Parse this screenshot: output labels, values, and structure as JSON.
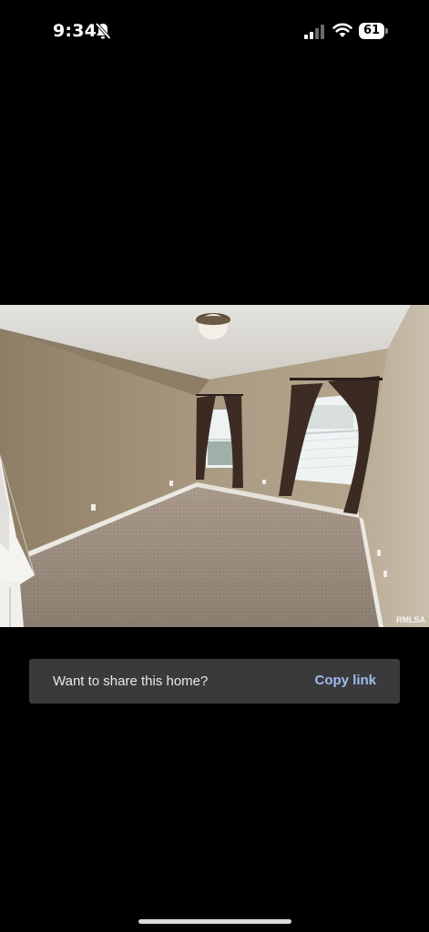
{
  "status_bar": {
    "time": "9:34",
    "battery_level": "61",
    "icons": [
      "bell-slash-icon",
      "cellular-signal-icon",
      "wifi-icon",
      "battery-icon"
    ]
  },
  "photo": {
    "watermark": "RMLSA"
  },
  "share": {
    "prompt": "Want to share this home?",
    "action_label": "Copy link"
  },
  "colors": {
    "background": "#000000",
    "banner": "#3a3a3c",
    "link": "#9fbcf0"
  }
}
